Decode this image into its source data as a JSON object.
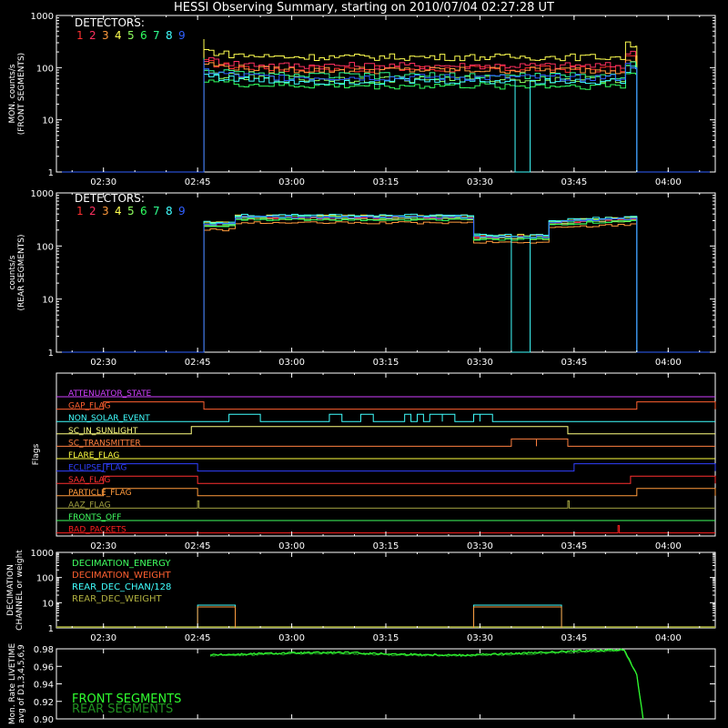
{
  "title": "HESSI Observing Summary, starting on 2010/07/04 02:27:28 UT",
  "colors": {
    "bg": "#000000",
    "axis": "#ffffff",
    "detectors": [
      "#ff3030",
      "#ff3060",
      "#ff9a3c",
      "#ffff50",
      "#90ff60",
      "#30ff60",
      "#30ff90",
      "#40ffff",
      "#3060ff"
    ]
  },
  "time_axis": {
    "start_min": 142.5,
    "end_min": 247.5,
    "ticks": [
      "02:30",
      "02:45",
      "03:00",
      "03:15",
      "03:30",
      "03:45",
      "04:00"
    ],
    "tick_min": [
      150,
      165,
      180,
      195,
      210,
      225,
      240
    ]
  },
  "chart_data": [
    {
      "type": "line",
      "id": "front",
      "ylabel": "MON. counts/s\n(FRONT SEGMENTS)",
      "yscale": "log",
      "ylim": [
        1,
        1000
      ],
      "yticks": [
        "1",
        "10",
        "100",
        "1000"
      ],
      "legend_title": "DETECTORS:",
      "legend_labels": [
        "1",
        "2",
        "3",
        "4",
        "5",
        "6",
        "7",
        "8",
        "9"
      ],
      "x_on_start": "02:46",
      "x_off_end": "03:55",
      "series": [
        {
          "name": "1",
          "level": 95
        },
        {
          "name": "2",
          "level": 110
        },
        {
          "name": "3",
          "level": 90
        },
        {
          "name": "4",
          "level": 160
        },
        {
          "name": "5",
          "level": 60
        },
        {
          "name": "6",
          "level": 45
        },
        {
          "name": "7",
          "level": 70
        },
        {
          "name": "8",
          "level": 55,
          "gap": [
            "03:35",
            "03:38"
          ]
        },
        {
          "name": "9",
          "level": 65
        }
      ]
    },
    {
      "type": "line",
      "id": "rear",
      "ylabel": "counts/s\n(REAR SEGMENTS)",
      "yscale": "log",
      "ylim": [
        1,
        1000
      ],
      "yticks": [
        "1",
        "10",
        "100",
        "1000"
      ],
      "legend_title": "DETECTORS:",
      "legend_labels": [
        "1",
        "2",
        "3",
        "4",
        "5",
        "6",
        "7",
        "8",
        "9"
      ],
      "segments": [
        {
          "from": "02:46",
          "to": "02:51",
          "level": 260
        },
        {
          "from": "02:51",
          "to": "03:29",
          "level": 350
        },
        {
          "from": "03:29",
          "to": "03:41",
          "level": 150
        },
        {
          "from": "03:41",
          "to": "03:55",
          "level": 280
        }
      ],
      "gap_series": "8",
      "gap": [
        "03:35",
        "03:38"
      ]
    },
    {
      "type": "line",
      "id": "flags",
      "ylabel": "Flags",
      "flags": [
        {
          "name": "ATTENUATOR_STATE",
          "color": "#d040ff",
          "on": []
        },
        {
          "name": "GAP_FLAG",
          "color": "#ff6030",
          "on": [
            [
              "02:30",
              "02:46"
            ],
            [
              "03:55",
              "04:08"
            ]
          ]
        },
        {
          "name": "NON_SOLAR_EVENT",
          "color": "#40ffff",
          "on": [
            [
              "02:50",
              "02:55"
            ],
            [
              "03:06",
              "03:08"
            ],
            [
              "03:11",
              "03:13"
            ],
            [
              "03:18",
              "03:19"
            ],
            [
              "03:20",
              "03:21"
            ],
            [
              "03:22",
              "03:24"
            ],
            [
              "03:24",
              "03:26"
            ],
            [
              "03:29",
              "03:30"
            ],
            [
              "03:30",
              "03:32"
            ]
          ]
        },
        {
          "name": "SC_IN_SUNLIGHT",
          "color": "#ffff80",
          "on": [
            [
              "02:44",
              "03:44"
            ]
          ]
        },
        {
          "name": "SC_TRANSMITTER",
          "color": "#ff8040",
          "on": [
            [
              "03:35",
              "03:39"
            ],
            [
              "03:39",
              "03:44"
            ]
          ]
        },
        {
          "name": "FLARE_FLAG",
          "color": "#ffff40",
          "on": []
        },
        {
          "name": "ECLIPSE_FLAG",
          "color": "#3040ff",
          "on": [
            [
              "02:30",
              "02:45"
            ],
            [
              "03:45",
              "04:08"
            ]
          ]
        },
        {
          "name": "SAA_FLAG",
          "color": "#ff3030",
          "on": [
            [
              "02:30",
              "02:45"
            ],
            [
              "03:54",
              "04:08"
            ]
          ]
        },
        {
          "name": "PARTICLE_FLAG",
          "color": "#ff9a3c",
          "on": [
            [
              "02:30",
              "02:45"
            ],
            [
              "03:55",
              "04:08"
            ]
          ]
        },
        {
          "name": "AAZ_FLAG",
          "color": "#a0a040",
          "on": [
            [
              "02:45",
              "02:45"
            ],
            [
              "03:44",
              "03:44"
            ]
          ]
        },
        {
          "name": "FRONTS_OFF",
          "color": "#40ff60",
          "on": []
        },
        {
          "name": "BAD_PACKETS",
          "color": "#ff2020",
          "on": [
            [
              "03:52",
              "03:52"
            ]
          ]
        }
      ]
    },
    {
      "type": "line",
      "id": "decimation",
      "ylabel": "DECIMATION\nCHANNEL or weight",
      "yscale": "log",
      "ylim": [
        1,
        1000
      ],
      "yticks": [
        "1",
        "10",
        "100",
        "1000"
      ],
      "legend": [
        {
          "name": "DECIMATION_ENERGY",
          "color": "#40ff60"
        },
        {
          "name": "DECIMATION_WEIGHT",
          "color": "#ff6030"
        },
        {
          "name": "REAR_DEC_CHAN/128",
          "color": "#40ffff"
        },
        {
          "name": "REAR_DEC_WEIGHT",
          "color": "#b0b040"
        }
      ],
      "rear_dec_chan_blocks": [
        [
          "02:45",
          "02:51",
          "8"
        ],
        [
          "03:29",
          "03:43",
          "8"
        ]
      ]
    },
    {
      "type": "line",
      "id": "livetime",
      "ylabel": "Mon. Rate LIVETIME\navg of D1,3,4,5,6,9",
      "ylim": [
        0.9,
        0.98
      ],
      "yticks": [
        "0.90",
        "0.92",
        "0.94",
        "0.96",
        "0.98"
      ],
      "series": [
        {
          "name": "FRONT SEGMENTS",
          "color": "#30ff30",
          "from": "02:47",
          "to": "03:55",
          "points": [
            [
              0,
              0.973
            ],
            [
              10,
              0.975
            ],
            [
              20,
              0.976
            ],
            [
              30,
              0.974
            ],
            [
              40,
              0.973
            ],
            [
              50,
              0.975
            ],
            [
              60,
              0.978
            ],
            [
              66,
              0.979
            ],
            [
              68,
              0.95
            ],
            [
              69,
              0.9
            ]
          ]
        },
        {
          "name": "REAR SEGMENTS",
          "color": "#209020",
          "from": "02:47",
          "to": "03:55",
          "points": [
            [
              0,
              0.972
            ],
            [
              10,
              0.974
            ],
            [
              20,
              0.975
            ],
            [
              30,
              0.973
            ],
            [
              40,
              0.972
            ],
            [
              50,
              0.974
            ],
            [
              60,
              0.977
            ],
            [
              66,
              0.978
            ],
            [
              68,
              0.95
            ],
            [
              69,
              0.9
            ]
          ]
        }
      ]
    }
  ]
}
